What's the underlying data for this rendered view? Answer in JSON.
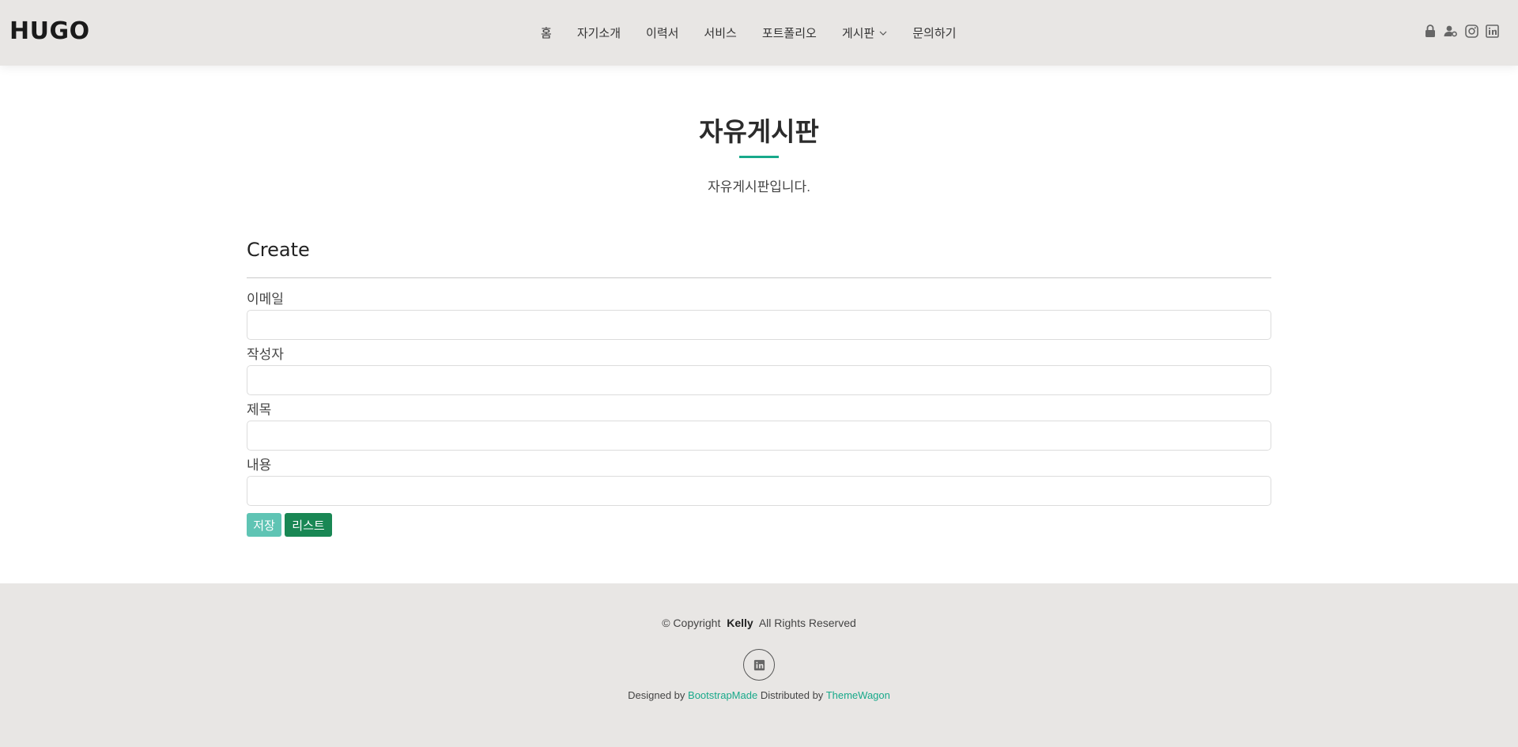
{
  "header": {
    "logo": "HUGO",
    "nav": [
      {
        "label": "홈"
      },
      {
        "label": "자기소개"
      },
      {
        "label": "이력서"
      },
      {
        "label": "서비스"
      },
      {
        "label": "포트폴리오"
      },
      {
        "label": "게시판",
        "dropdown": true
      },
      {
        "label": "문의하기"
      }
    ],
    "icons": [
      "lock-icon",
      "user-gear-icon",
      "instagram-icon",
      "linkedin-icon"
    ]
  },
  "section": {
    "title": "자유게시판",
    "subtitle": "자유게시판입니다."
  },
  "form": {
    "heading": "Create",
    "fields": [
      {
        "label": "이메일",
        "value": ""
      },
      {
        "label": "작성자",
        "value": ""
      },
      {
        "label": "제목",
        "value": ""
      },
      {
        "label": "내용",
        "value": ""
      }
    ],
    "save_label": "저장",
    "list_label": "리스트"
  },
  "footer": {
    "copyright_prefix": "© Copyright",
    "copyright_name": "Kelly",
    "copyright_suffix": "All Rights Reserved",
    "designed_by": "Designed by",
    "designer": "BootstrapMade",
    "distributed_by": "Distributed by",
    "distributor": "ThemeWagon",
    "social_icon": "linkedin-icon"
  },
  "colors": {
    "accent": "#18a98a",
    "save_button": "#5fc4b4",
    "list_button": "#198754",
    "header_bg": "#e8e6e4"
  }
}
